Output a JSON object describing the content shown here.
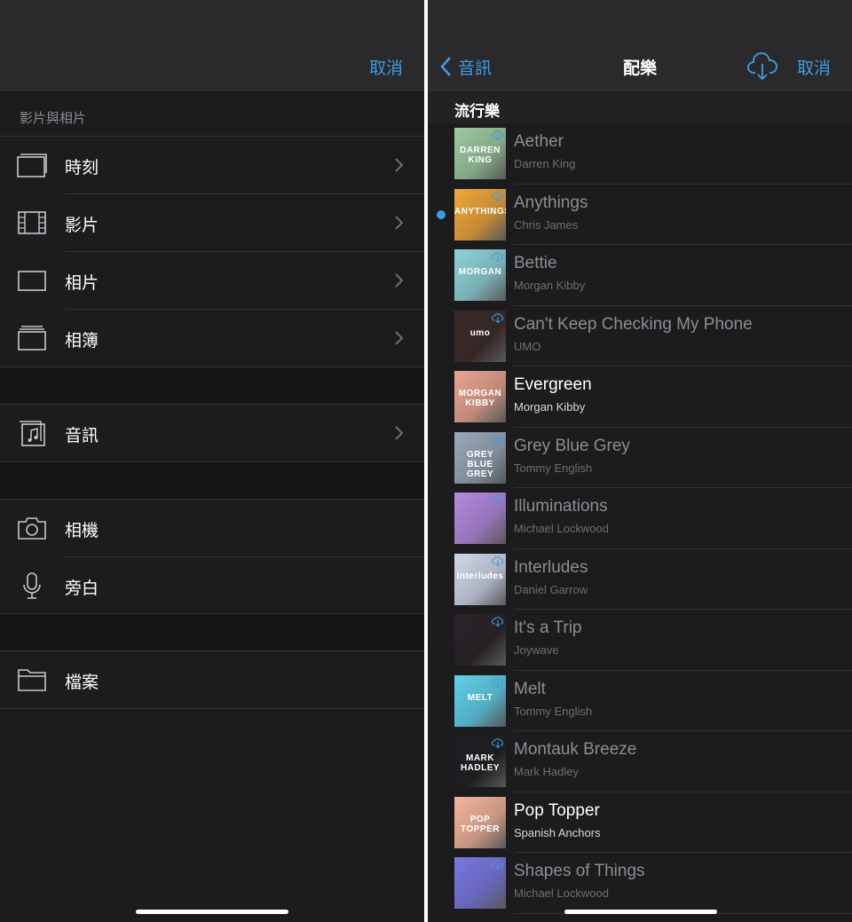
{
  "left_panel": {
    "cancel_label": "取消",
    "section_label": "影片與相片",
    "items": [
      {
        "label": "時刻",
        "icon": "moments-icon"
      },
      {
        "label": "影片",
        "icon": "film-icon"
      },
      {
        "label": "相片",
        "icon": "photo-icon"
      },
      {
        "label": "相簿",
        "icon": "album-icon"
      },
      {
        "label": "音訊",
        "icon": "audio-icon"
      },
      {
        "label": "相機",
        "icon": "camera-icon"
      },
      {
        "label": "旁白",
        "icon": "microphone-icon"
      },
      {
        "label": "檔案",
        "icon": "folder-icon"
      }
    ]
  },
  "right_panel": {
    "back_label": "音訊",
    "title": "配樂",
    "cancel_label": "取消",
    "genre": "流行樂",
    "tracks": [
      {
        "title": "Aether",
        "artist": "Darren King",
        "art_text": "DARREN KING",
        "art_bg": "#9ec9a0",
        "downloaded": false,
        "selected": false
      },
      {
        "title": "Anythings",
        "artist": "Chris James",
        "art_text": "ANYTHINGS",
        "art_bg": "#f0a63a",
        "downloaded": false,
        "selected": true
      },
      {
        "title": "Bettie",
        "artist": "Morgan Kibby",
        "art_text": "MORGAN",
        "art_bg": "#8fd3d8",
        "downloaded": false,
        "selected": false
      },
      {
        "title": "Can't Keep Checking My Phone",
        "artist": "UMO",
        "art_text": "umo",
        "art_bg": "#3a2a28",
        "downloaded": false,
        "selected": false
      },
      {
        "title": "Evergreen",
        "artist": "Morgan Kibby",
        "art_text": "MORGAN KIBBY",
        "art_bg": "#e8a490",
        "downloaded": true,
        "selected": false
      },
      {
        "title": "Grey Blue Grey",
        "artist": "Tommy English",
        "art_text": "GREY BLUE GREY",
        "art_bg": "#9aa8b8",
        "downloaded": false,
        "selected": false
      },
      {
        "title": "Illuminations",
        "artist": "Michael Lockwood",
        "art_text": "",
        "art_bg": "#b48ae0",
        "downloaded": false,
        "selected": false
      },
      {
        "title": "Interludes",
        "artist": "Daniel Garrow",
        "art_text": "Interludes",
        "art_bg": "#cfd8e8",
        "downloaded": false,
        "selected": false
      },
      {
        "title": "It's a Trip",
        "artist": "Joywave",
        "art_text": "",
        "art_bg": "#2a2228",
        "downloaded": false,
        "selected": false
      },
      {
        "title": "Melt",
        "artist": "Tommy English",
        "art_text": "MELT",
        "art_bg": "#5fd0ea",
        "downloaded": false,
        "selected": false
      },
      {
        "title": "Montauk Breeze",
        "artist": "Mark Hadley",
        "art_text": "MARK HADLEY",
        "art_bg": "#1e1e22",
        "downloaded": false,
        "selected": false
      },
      {
        "title": "Pop Topper",
        "artist": "Spanish Anchors",
        "art_text": "POP TOPPER",
        "art_bg": "#f2b49a",
        "downloaded": true,
        "selected": false
      },
      {
        "title": "Shapes of Things",
        "artist": "Michael Lockwood",
        "art_text": "",
        "art_bg": "#7a78e0",
        "downloaded": false,
        "selected": false
      }
    ]
  },
  "colors": {
    "accent": "#3d9ce4",
    "background": "#1c1c1e",
    "navbar": "#2a2a2c"
  }
}
